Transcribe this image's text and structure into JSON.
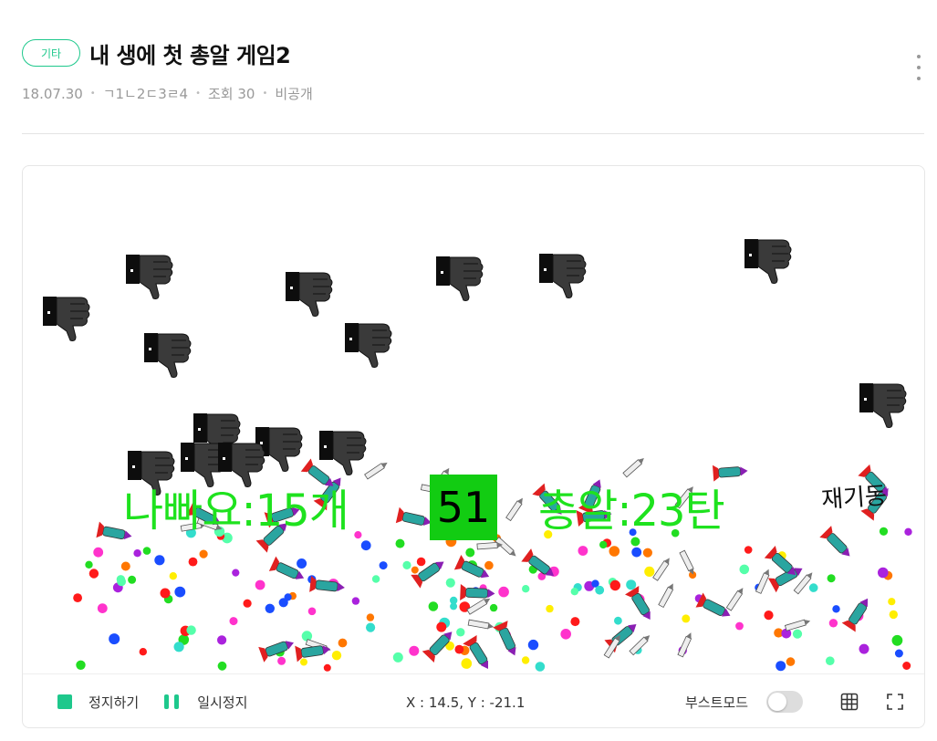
{
  "post": {
    "category": "기타",
    "title": "내 생에 첫 총알 게임2",
    "date": "18.07.30",
    "author": "ㄱ1ㄴ2ㄷ3ㄹ4",
    "views": "조회 30",
    "visibility": "비공개"
  },
  "game": {
    "dislike_label": "나빠요:15개",
    "timer": "51",
    "ammo_label": "총알:23탄",
    "restart_label": "재기동",
    "colors": {
      "hud": "#1ee21e",
      "timer_bg": "#12cc12",
      "accent": "#1ec88c"
    },
    "sprites": {
      "enemy": "thumbs-down-icon",
      "player_projectile": "rocket-icon"
    }
  },
  "controls": {
    "stop_label": "정지하기",
    "pause_label": "일시정지",
    "coords": "X : 14.5, Y : -21.1",
    "boost_label": "부스트모드",
    "boost_on": false
  }
}
